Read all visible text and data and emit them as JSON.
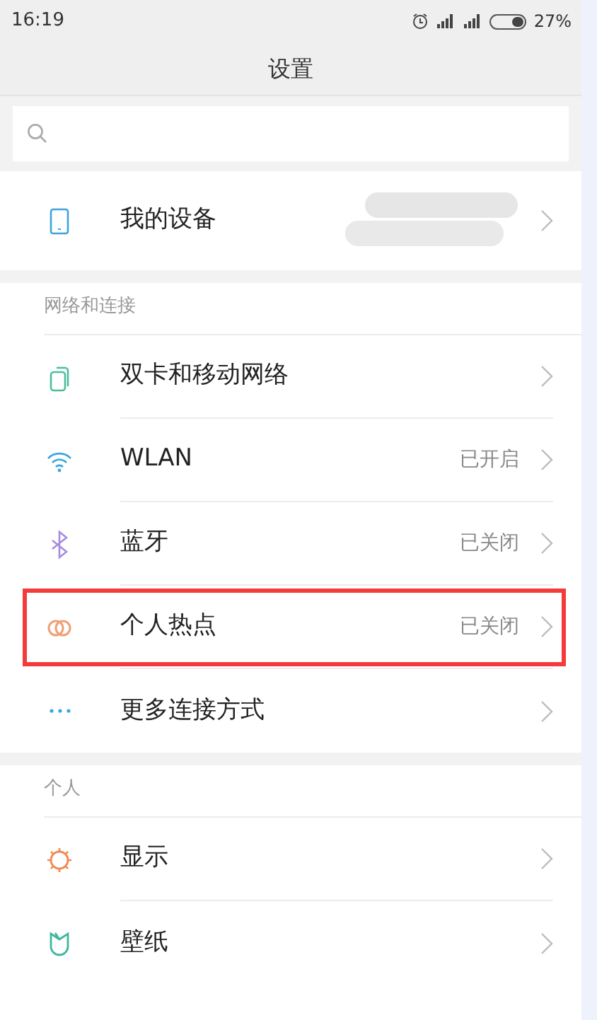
{
  "status_bar": {
    "time": "16:19",
    "battery_text": "27%"
  },
  "title": "设置",
  "device": {
    "label": "我的设备",
    "redacted": true
  },
  "sections": [
    {
      "header": "网络和连接",
      "items": [
        {
          "kind": "sim",
          "label": "双卡和移动网络",
          "highlighted": false
        },
        {
          "kind": "wifi",
          "label": "WLAN",
          "value": "已开启",
          "highlighted": false
        },
        {
          "kind": "bluetooth",
          "label": "蓝牙",
          "value": "已关闭",
          "highlighted": false
        },
        {
          "kind": "hotspot",
          "label": "个人热点",
          "value": "已关闭",
          "highlighted": true
        },
        {
          "kind": "more",
          "label": "更多连接方式",
          "highlighted": false
        }
      ]
    },
    {
      "header": "个人",
      "items": [
        {
          "kind": "display",
          "label": "显示",
          "highlighted": false
        },
        {
          "kind": "wallpaper",
          "label": "壁纸",
          "highlighted": false
        }
      ]
    }
  ]
}
